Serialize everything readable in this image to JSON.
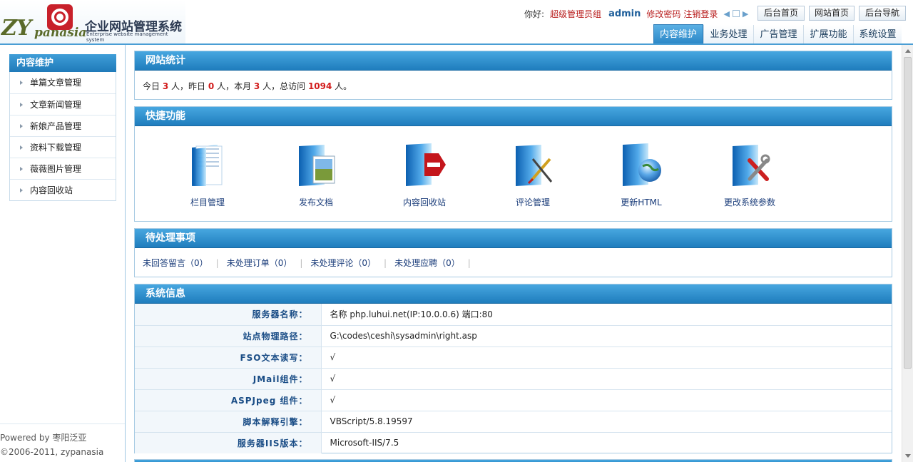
{
  "header": {
    "logo": {
      "script": "ZYpanasia",
      "cn": "企业网站管理系统",
      "en": "Enterprise website management system"
    },
    "greeting": "你好:",
    "role": "超级管理员组",
    "username": "admin",
    "change_password": "修改密码",
    "logout": "注销登录",
    "buttons": [
      "后台首页",
      "网站首页",
      "后台导航"
    ],
    "tabs": [
      "内容维护",
      "业务处理",
      "广告管理",
      "扩展功能",
      "系统设置"
    ]
  },
  "sidebar": {
    "title": "内容维护",
    "items": [
      "单篇文章管理",
      "文章新闻管理",
      "新娘产品管理",
      "资料下载管理",
      "薇薇图片管理",
      "内容回收站"
    ],
    "powered_by": "Powered by 枣阳泛亚",
    "copyright": "©2006-2011, zypanasia"
  },
  "stats": {
    "title": "网站统计",
    "t1": "今日",
    "today": "3",
    "t2": "人，昨日",
    "yesterday": "0",
    "t3": "人，本月",
    "month": "3",
    "t4": "人，总访问",
    "total": "1094",
    "t5": "人。"
  },
  "shortcuts": {
    "title": "快捷功能",
    "items": [
      "栏目管理",
      "发布文档",
      "内容回收站",
      "评论管理",
      "更新HTML",
      "更改系统参数"
    ]
  },
  "pending": {
    "title": "待处理事项",
    "items": [
      "未回答留言（0）",
      "未处理订单（0）",
      "未处理评论（0）",
      "未处理应聘（0）"
    ]
  },
  "sysinfo": {
    "title": "系统信息",
    "rows": [
      {
        "k": "服务器名称：",
        "v": "名称 php.luhui.net(IP:10.0.0.6) 端口:80"
      },
      {
        "k": "站点物理路径：",
        "v": "G:\\codes\\ceshi\\sysadmin\\right.asp"
      },
      {
        "k": "FSO文本读写：",
        "v": "√"
      },
      {
        "k": "JMail组件：",
        "v": "√"
      },
      {
        "k": "ASPJpeg 组件：",
        "v": "√"
      },
      {
        "k": "脚本解释引擎：",
        "v": "VBScript/5.8.19597"
      },
      {
        "k": "服务器IIS版本：",
        "v": "Microsoft-IIS/7.5"
      }
    ]
  },
  "colors": {
    "accent": "#2a86c6",
    "highlight": "#d21b1b",
    "link": "#1a3c7a"
  }
}
